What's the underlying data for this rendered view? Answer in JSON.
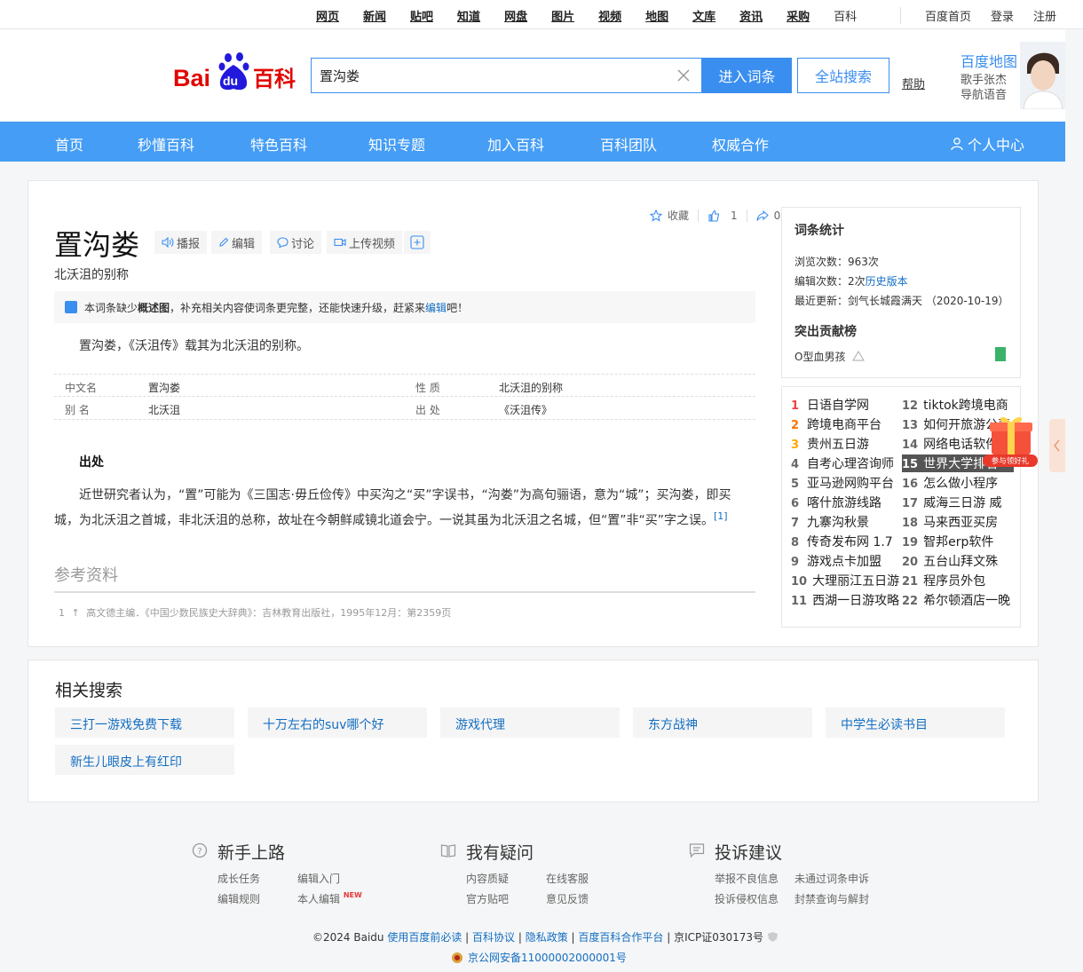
{
  "topnav": {
    "items": [
      "网页",
      "新闻",
      "贴吧",
      "知道",
      "网盘",
      "图片",
      "视频",
      "地图",
      "文库",
      "资讯",
      "采购",
      "百科"
    ],
    "right_links": [
      "百度首页",
      "登录",
      "注册"
    ]
  },
  "header": {
    "logo_text_bai": "Bai",
    "logo_text_du": "du",
    "logo_text_baike": "百科",
    "search_value": "置沟娄",
    "enter_button": "进入词条",
    "all_search_button": "全站搜索",
    "help": "帮助",
    "ad": {
      "title": "百度地图",
      "line1": "歌手张杰",
      "line2": "导航语音"
    }
  },
  "mainnav": {
    "items": [
      "首页",
      "秒懂百科",
      "特色百科",
      "知识专题",
      "加入百科",
      "百科团队",
      "权威合作"
    ],
    "user": "个人中心"
  },
  "entry": {
    "title": "置沟娄",
    "tools": [
      "播报",
      "编辑",
      "讨论",
      "上传视频"
    ],
    "subtitle": "北沃沮的别称",
    "actions": {
      "collect": "收藏",
      "likes": "1",
      "shares": "0"
    },
    "notice": {
      "pre": "本词条缺少",
      "bold": "概述图",
      "mid": "，补充相关内容使词条更完整，还能快速升级，赶紧来",
      "link": "编辑",
      "post": "吧！"
    },
    "summary": "置沟娄，《沃沮传》载其为北沃沮的别称。",
    "basic_info": [
      {
        "n1": "中文名",
        "v1": "置沟娄",
        "n2": "性    质",
        "v2": "北沃沮的别称"
      },
      {
        "n1": "别    名",
        "v1": "北沃沮",
        "n2": "出    处",
        "v2": "《沃沮传》"
      }
    ],
    "section_title": "出处",
    "paragraph": "近世研究者认为，“置”可能为《三国志·毋丘俭传》中买沟之“买”字误书，“沟娄”为高句骊语，意为“城”；买沟娄，即买城，为北沃沮之首城，非北沃沮的总称，故址在今朝鲜咸镜北道会宁。一说其虽为北沃沮之名城，但“置”非“买”字之误。",
    "ref_mark": "[1]",
    "ref_title": "参考资料",
    "ref_item_num": "1",
    "ref_item": "高文德主编．《中国少数民族史大辞典》：吉林教育出版社，1995年12月：第2359页"
  },
  "stats": {
    "title": "词条统计",
    "views": "浏览次数：963次",
    "edits": "编辑次数：2次",
    "history_link": "历史版本",
    "updated": "最近更新：剑气长城霞满天 （2020-10-19）",
    "contrib_title": "突出贡献榜",
    "contrib_user": "O型血男孩"
  },
  "hot": {
    "left": [
      {
        "n": "1",
        "t": "日语自学网"
      },
      {
        "n": "2",
        "t": "跨境电商平台"
      },
      {
        "n": "3",
        "t": "贵州五日游"
      },
      {
        "n": "4",
        "t": "自考心理咨询师"
      },
      {
        "n": "5",
        "t": "亚马逊网购平台"
      },
      {
        "n": "6",
        "t": "喀什旅游线路"
      },
      {
        "n": "7",
        "t": "九寨沟秋景"
      },
      {
        "n": "8",
        "t": "传奇发布网 1.7"
      },
      {
        "n": "9",
        "t": "游戏点卡加盟"
      },
      {
        "n": "10",
        "t": "大理丽江五日游"
      },
      {
        "n": "11",
        "t": "西湖一日游攻略"
      }
    ],
    "right": [
      {
        "n": "12",
        "t": "tiktok跨境电商"
      },
      {
        "n": "13",
        "t": "如何开旅游公司"
      },
      {
        "n": "14",
        "t": "网络电话软件"
      },
      {
        "n": "15",
        "t": "世界大学排名"
      },
      {
        "n": "16",
        "t": "怎么做小程序"
      },
      {
        "n": "17",
        "t": "威海三日游 威"
      },
      {
        "n": "18",
        "t": "马来西亚买房"
      },
      {
        "n": "19",
        "t": "智邦erp软件"
      },
      {
        "n": "20",
        "t": "五台山拜文殊"
      },
      {
        "n": "21",
        "t": "程序员外包"
      },
      {
        "n": "22",
        "t": "希尔顿酒店一晚"
      }
    ],
    "gift_label": "参与领好礼"
  },
  "related": {
    "title": "相关搜索",
    "items": [
      "三打一游戏免费下载",
      "十万左右的suv哪个好",
      "游戏代理",
      "东方战神",
      "中学生必读书目",
      "新生儿眼皮上有红印"
    ]
  },
  "footer": {
    "cols": [
      {
        "title": "新手上路",
        "links": [
          "成长任务",
          "编辑入门",
          "编辑规则",
          "本人编辑"
        ]
      },
      {
        "title": "我有疑问",
        "links": [
          "内容质疑",
          "在线客服",
          "官方贴吧",
          "意见反馈"
        ]
      },
      {
        "title": "投诉建议",
        "links": [
          "举报不良信息",
          "未通过词条申诉",
          "投诉侵权信息",
          "封禁查询与解封"
        ]
      }
    ],
    "new_tag": "NEW",
    "copyright_pre": "©2024 Baidu ",
    "copyright_links": [
      "使用百度前必读",
      "百科协议",
      "隐私政策",
      "百度百科合作平台"
    ],
    "icp": "京ICP证030173号",
    "police": "京公网安备11000002000001号"
  },
  "colors": {
    "brand_blue": "#3a8ef0",
    "nav_blue": "#459df5",
    "link": "#136ec2",
    "rank_red": "#f04142"
  }
}
